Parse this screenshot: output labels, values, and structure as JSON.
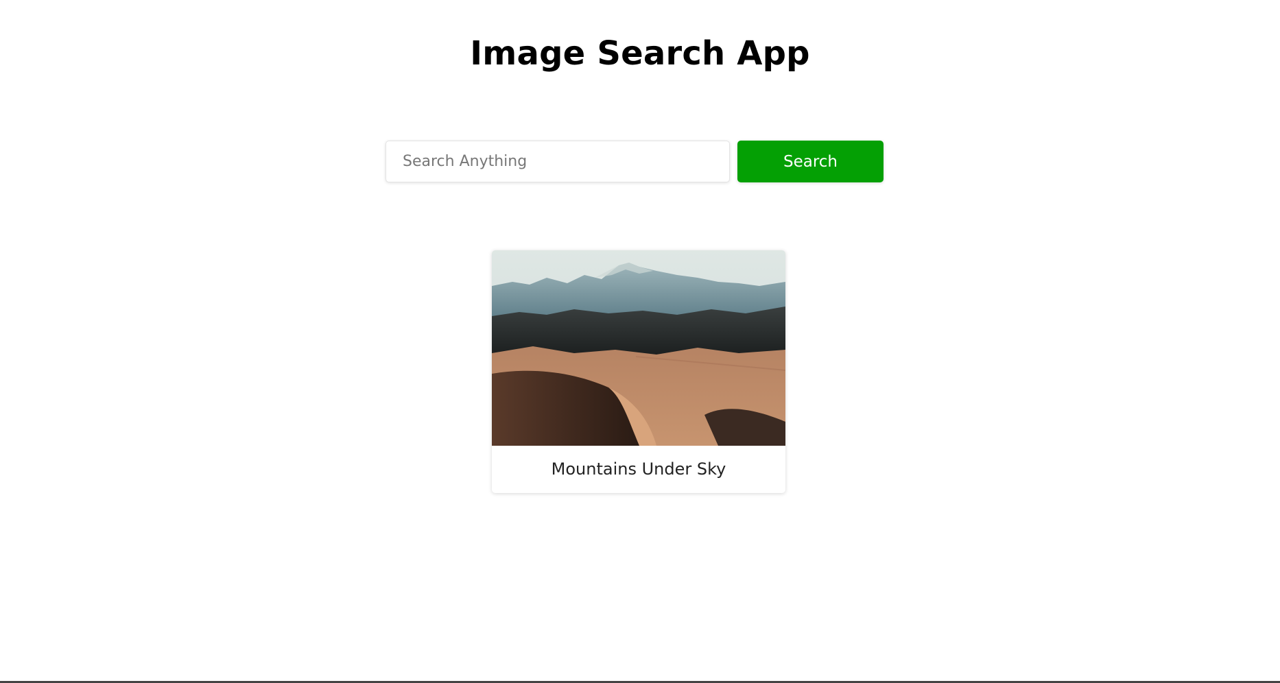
{
  "app": {
    "title": "Image Search App"
  },
  "search": {
    "placeholder": "Search Anything",
    "value": "",
    "button_label": "Search"
  },
  "results": [
    {
      "caption": "Mountains Under Sky",
      "image": "desert-dunes-mountains-photo"
    }
  ],
  "colors": {
    "accent": "#04a004",
    "text": "#000000",
    "caption_text": "#222222",
    "background": "#ffffff"
  }
}
